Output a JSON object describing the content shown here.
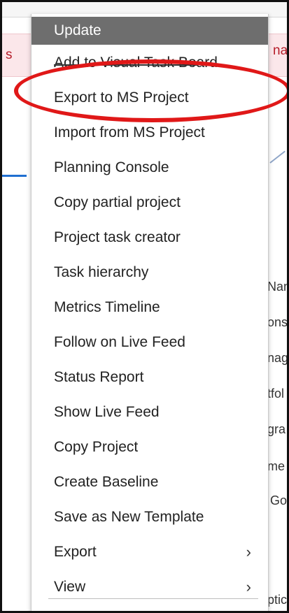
{
  "background": {
    "left_fragment": "s",
    "right_fragment": "nall",
    "right_labels": [
      "Nam",
      "ons",
      "nag",
      "tfol",
      "gra",
      "me",
      "Go",
      "ptic"
    ]
  },
  "menu": {
    "items": [
      {
        "label": "Update",
        "active": true,
        "has_submenu": false
      },
      {
        "label": "Add to Visual Task Board",
        "active": false,
        "has_submenu": false
      },
      {
        "label": "Export to MS Project",
        "active": false,
        "has_submenu": false
      },
      {
        "label": "Import from MS Project",
        "active": false,
        "has_submenu": false
      },
      {
        "label": "Planning Console",
        "active": false,
        "has_submenu": false
      },
      {
        "label": "Copy partial project",
        "active": false,
        "has_submenu": false
      },
      {
        "label": "Project task creator",
        "active": false,
        "has_submenu": false
      },
      {
        "label": "Task hierarchy",
        "active": false,
        "has_submenu": false
      },
      {
        "label": "Metrics Timeline",
        "active": false,
        "has_submenu": false
      },
      {
        "label": "Follow on Live Feed",
        "active": false,
        "has_submenu": false
      },
      {
        "label": "Status Report",
        "active": false,
        "has_submenu": false
      },
      {
        "label": "Show Live Feed",
        "active": false,
        "has_submenu": false
      },
      {
        "label": "Copy Project",
        "active": false,
        "has_submenu": false
      },
      {
        "label": "Create Baseline",
        "active": false,
        "has_submenu": false
      },
      {
        "label": "Save as New Template",
        "active": false,
        "has_submenu": false
      },
      {
        "label": "Export",
        "active": false,
        "has_submenu": true
      },
      {
        "label": "View",
        "active": false,
        "has_submenu": true
      }
    ],
    "submenu_icon": "chevron-right-icon"
  },
  "annotation": {
    "target": "Export to MS Project",
    "color": "#e01818"
  }
}
